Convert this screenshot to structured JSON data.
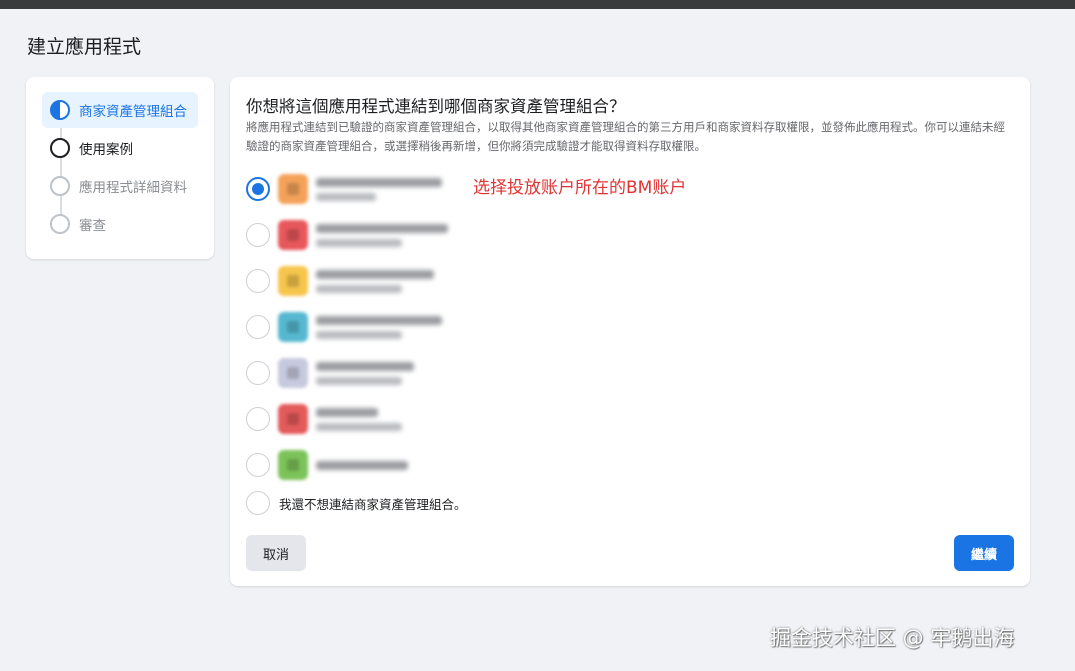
{
  "page": {
    "title": "建立應用程式"
  },
  "sidebar": {
    "steps": [
      {
        "label": "商家資產管理組合",
        "state": "active"
      },
      {
        "label": "使用案例",
        "state": "upcoming"
      },
      {
        "label": "應用程式詳細資料",
        "state": "disabled"
      },
      {
        "label": "審查",
        "state": "disabled"
      }
    ]
  },
  "main": {
    "question": "你想將這個應用程式連結到哪個商家資產管理組合？",
    "description": "將應用程式連結到已驗證的商家資產管理組合，以取得其他商家資產管理組合的第三方用戶和商家資料存取權限，並發佈此應用程式。你可以連結未經驗證的商家資產管理組合，或選擇稍後再新增，但你將須完成驗證才能取得資料存取權限。",
    "options": [
      {
        "selected": true,
        "icon_color": "#f4a25a",
        "name": "",
        "status": ""
      },
      {
        "selected": false,
        "icon_color": "#e7575b",
        "name": "",
        "status": ""
      },
      {
        "selected": false,
        "icon_color": "#f6c54c",
        "name": "",
        "status": ""
      },
      {
        "selected": false,
        "icon_color": "#56b8d0",
        "name": "",
        "status": ""
      },
      {
        "selected": false,
        "icon_color": "#c7c9de",
        "name": "",
        "status": ""
      },
      {
        "selected": false,
        "icon_color": "#e35a5a",
        "name": "",
        "status": ""
      },
      {
        "selected": false,
        "icon_color": "#7cc35a",
        "name": "",
        "status": ""
      }
    ],
    "no_connect_label": "我還不想連結商家資產管理組合。",
    "annotation": "选择投放账户所在的BM账户"
  },
  "footer": {
    "cancel_label": "取消",
    "continue_label": "繼續"
  },
  "watermark": "掘金技术社区 @ 牢鹅出海",
  "colors": {
    "accent": "#1b74e4",
    "annotation": "#e03434"
  }
}
